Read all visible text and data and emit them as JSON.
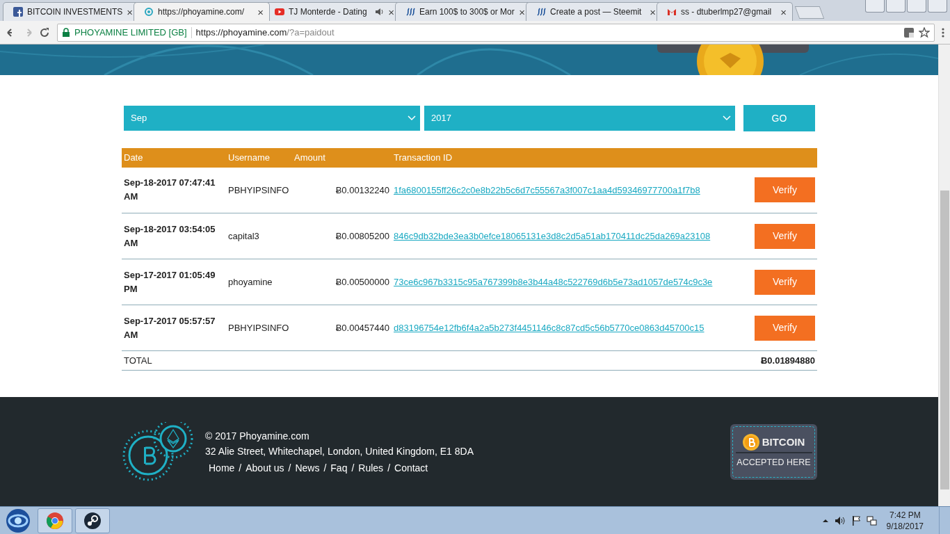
{
  "browser": {
    "tabs": [
      {
        "title": "BITCOIN INVESTMENTS",
        "kind": "facebook",
        "selected": false,
        "audio": false
      },
      {
        "title": "https://phoyamine.com/",
        "kind": "site",
        "selected": true,
        "audio": false
      },
      {
        "title": "TJ Monterde - Dating",
        "kind": "youtube",
        "selected": false,
        "audio": true
      },
      {
        "title": "Earn 100$ to 300$ or Mor",
        "kind": "steemit",
        "selected": false,
        "audio": false
      },
      {
        "title": "Create a post — Steemit",
        "kind": "steemit",
        "selected": false,
        "audio": false
      },
      {
        "title": "ss - dtuberlmp27@gmail",
        "kind": "gmail",
        "selected": false,
        "audio": false
      }
    ],
    "close_glyph": "×",
    "security_label": "PHOYAMINE LIMITED [GB]",
    "url_host": "https://phoyamine.com",
    "url_path": "/?a=paidout"
  },
  "filter": {
    "month": "Sep",
    "year": "2017",
    "button": "GO"
  },
  "table": {
    "columns": [
      "Date",
      "Username",
      "Amount",
      "Transaction ID"
    ],
    "rows": [
      {
        "date": "Sep-18-2017 07:47:41 AM",
        "username": "PBHYIPSINFO",
        "amount": "Ƀ0.00132240",
        "transaction_id": "1fa6800155ff26c2c0e8b22b5c6d7c55567a3f007c1aa4d59346977700a1f7b8",
        "action": "Verify"
      },
      {
        "date": "Sep-18-2017 03:54:05 AM",
        "username": "capital3",
        "amount": "Ƀ0.00805200",
        "transaction_id": "846c9db32bde3ea3b0efce18065131e3d8c2d5a51ab170411dc25da269a23108",
        "action": "Verify"
      },
      {
        "date": "Sep-17-2017 01:05:49 PM",
        "username": "phoyamine",
        "amount": "Ƀ0.00500000",
        "transaction_id": "73ce6c967b3315c95a767399b8e3b44a48c522769d6b5e73ad1057de574c9c3e",
        "action": "Verify"
      },
      {
        "date": "Sep-17-2017 05:57:57 AM",
        "username": "PBHYIPSINFO",
        "amount": "Ƀ0.00457440",
        "transaction_id": "d83196754e12fb6f4a2a5b273f4451146c8c87cd5c56b5770ce0863d45700c15",
        "action": "Verify"
      }
    ],
    "total_label": "TOTAL",
    "total": "Ƀ0.01894880"
  },
  "footer": {
    "copyright": "© 2017 Phoyamine.com",
    "address": "32 Alie Street, Whitechapel, London, United Kingdom, E1 8DA",
    "links": [
      "Home",
      "About us",
      "News",
      "Faq",
      "Rules",
      "Contact"
    ],
    "link_separator": "/",
    "badge_title": "BITCOIN",
    "badge_subtitle": "ACCEPTED HERE"
  },
  "taskbar": {
    "time": "7:42 PM",
    "date": "9/18/2017"
  }
}
